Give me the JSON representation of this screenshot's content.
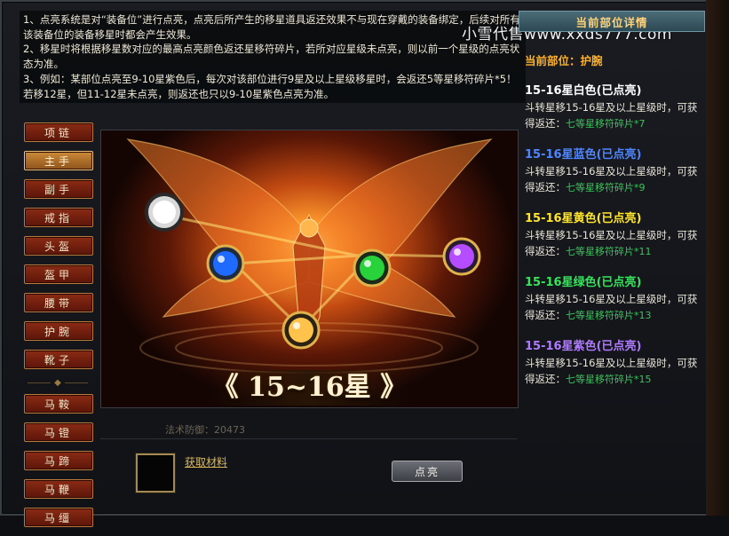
{
  "description": {
    "lines": [
      "1、点亮系统是对“装备位”进行点亮，点亮后所产生的移星道具返还效果不与现在穿戴的装备绑定，后续对所有该装备位的装备移星时都会产生效果。",
      "2、移星时将根据移星数对应的最高点亮颜色返还星移符碎片，若所对应星级未点亮，则以前一个星级的点亮状态为准。",
      "3、例如：某部位点亮至9-10星紫色后，每次对该部位进行9星及以上星级移星时，会返还5等星移符碎片*5！若移12星，但11-12星未点亮，则返还也只以9-10星紫色点亮为准。"
    ]
  },
  "watermark": "小雪代售www.xxds777.com",
  "tabs": [
    {
      "label": "项链",
      "active": false
    },
    {
      "label": "主手",
      "active": true
    },
    {
      "label": "副手",
      "active": false
    },
    {
      "label": "戒指",
      "active": false
    },
    {
      "label": "头盔",
      "active": false
    },
    {
      "label": "盔甲",
      "active": false
    },
    {
      "label": "腰带",
      "active": false
    },
    {
      "label": "护腕",
      "active": false
    },
    {
      "label": "靴子",
      "active": false
    }
  ],
  "mount_tabs": [
    {
      "label": "马鞍"
    },
    {
      "label": "马镫"
    },
    {
      "label": "马蹄"
    },
    {
      "label": "马鞭"
    },
    {
      "label": "马缰"
    }
  ],
  "phoenix": {
    "star_label": "15~16星",
    "orbs": [
      "white",
      "blue",
      "yellow",
      "green",
      "purple"
    ],
    "colors": {
      "white": "#e8e8e8",
      "blue": "#1f6bff",
      "yellow": "#ffc24a",
      "green": "#27d23a",
      "purple": "#b64cff"
    }
  },
  "bottom": {
    "material_link": "获取材料",
    "light_button": "点亮",
    "faint_text": "法术防御：20473"
  },
  "right_panel": {
    "title": "当前部位详情",
    "part": "当前部位：护腕",
    "items": [
      {
        "title": "15-16星白色(已点亮)",
        "color": "#ffffff",
        "desc": "斗转星移15-16星及以上星级时，可获得返还：",
        "reward": "七等星移符碎片*7"
      },
      {
        "title": "15-16星蓝色(已点亮)",
        "color": "#4f86ff",
        "desc": "斗转星移15-16星及以上星级时，可获得返还：",
        "reward": "七等星移符碎片*9"
      },
      {
        "title": "15-16星黄色(已点亮)",
        "color": "#ffe62a",
        "desc": "斗转星移15-16星及以上星级时，可获得返还：",
        "reward": "七等星移符碎片*11"
      },
      {
        "title": "15-16星绿色(已点亮)",
        "color": "#36e35b",
        "desc": "斗转星移15-16星及以上星级时，可获得返还：",
        "reward": "七等星移符碎片*13"
      },
      {
        "title": "15-16星紫色(已点亮)",
        "color": "#b07aff",
        "desc": "斗转星移15-16星及以上星级时，可获得返还：",
        "reward": "七等星移符碎片*15"
      }
    ]
  }
}
